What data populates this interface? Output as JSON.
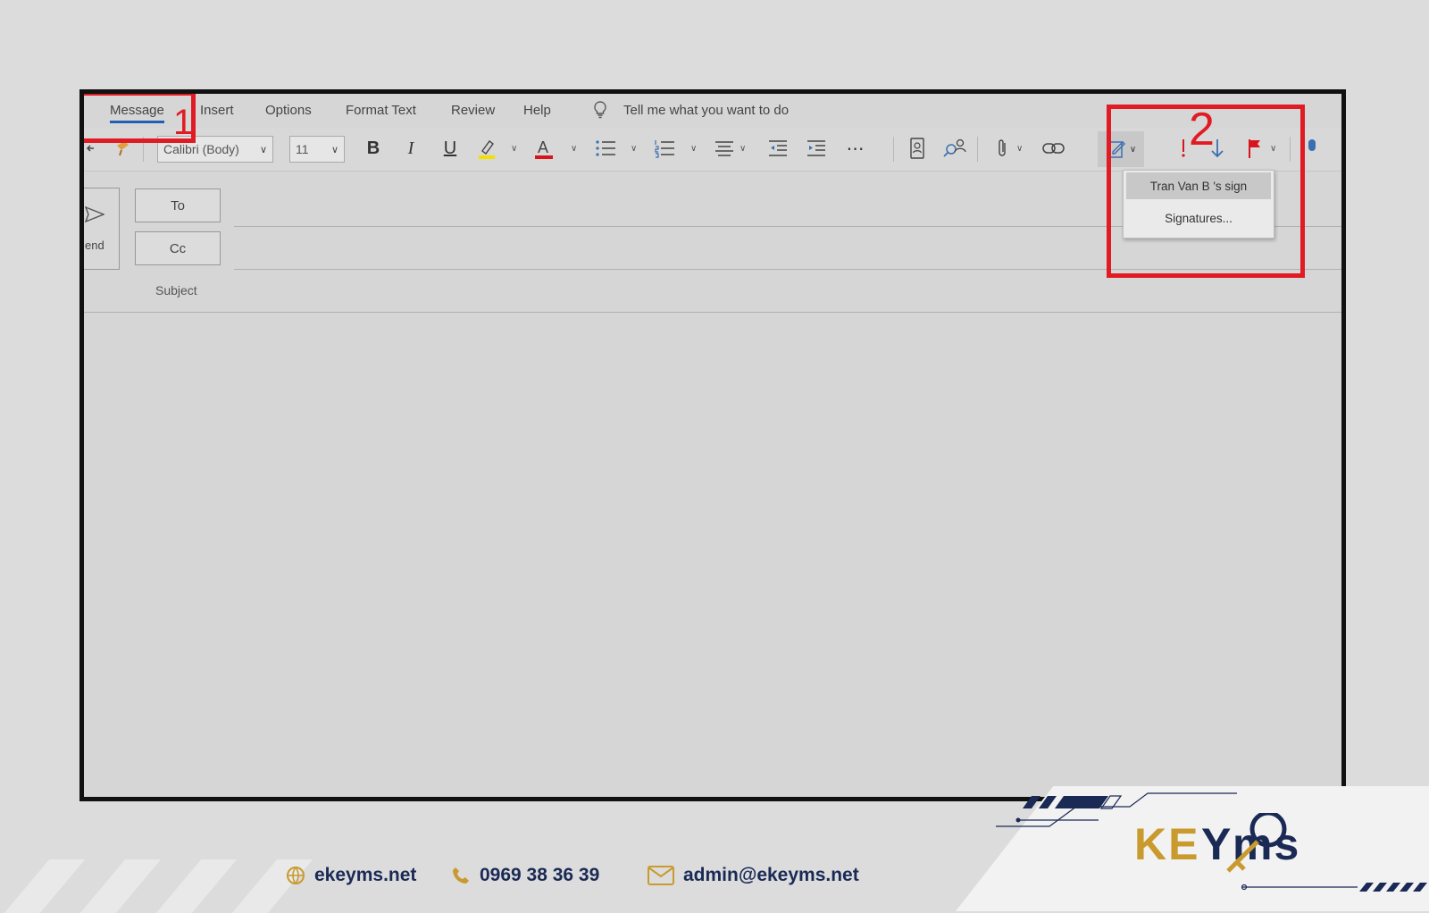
{
  "tabs": [
    "Message",
    "Insert",
    "Options",
    "Format Text",
    "Review",
    "Help"
  ],
  "tell_me": "Tell me what you want to do",
  "font_name": "Calibri (Body)",
  "font_size": "11",
  "fields": {
    "to": "To",
    "cc": "Cc",
    "subject": "Subject",
    "send": "end"
  },
  "signature_menu": {
    "items": [
      "Tran Van B 's sign",
      "Signatures..."
    ]
  },
  "annotations": {
    "step1": "1",
    "step2": "2",
    "color": "#e01b24"
  },
  "icons": [
    "undo-icon",
    "format-painter-icon",
    "bold-icon",
    "italic-icon",
    "underline-icon",
    "highlight-icon",
    "font-color-icon",
    "bullets-icon",
    "numbering-icon",
    "align-icon",
    "decrease-indent-icon",
    "increase-indent-icon",
    "more-icon",
    "address-book-icon",
    "check-names-icon",
    "attach-icon",
    "link-icon",
    "signature-icon",
    "high-importance-icon",
    "low-importance-icon",
    "flag-icon",
    "dictate-icon"
  ],
  "footer": {
    "website": "ekeyms.net",
    "phone": "0969 38 36 39",
    "email": "admin@ekeyms.net",
    "brand_colors": {
      "navy": "#1a2a55",
      "gold": "#c99a2e"
    }
  }
}
